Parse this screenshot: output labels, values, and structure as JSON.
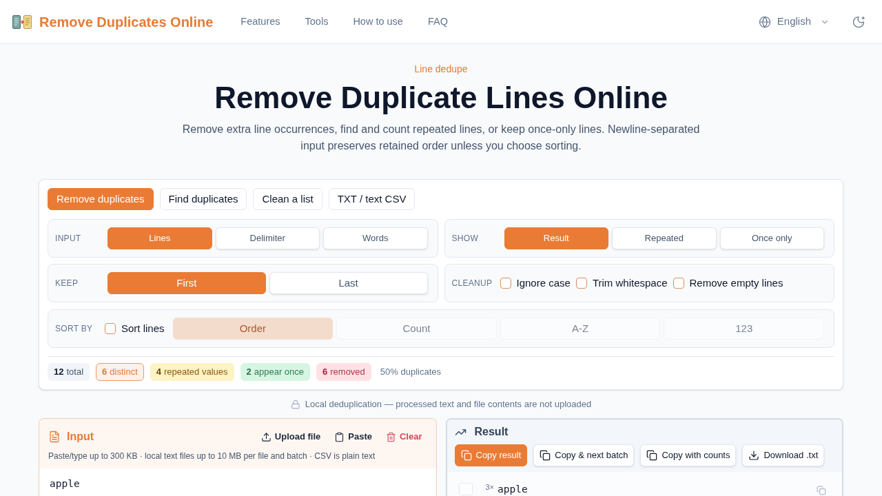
{
  "header": {
    "logo_title": "Remove Duplicates Online",
    "nav": [
      "Features",
      "Tools",
      "How to use",
      "FAQ"
    ],
    "language": "English"
  },
  "hero": {
    "eyebrow": "Line dedupe",
    "title": "Remove Duplicate Lines Online",
    "subtitle": "Remove extra line occurrences, find and count repeated lines, or keep once-only lines. Newline-separated input preserves retained order unless you choose sorting."
  },
  "tool": {
    "modes": [
      {
        "label": "Remove duplicates",
        "selected": true
      },
      {
        "label": "Find duplicates",
        "selected": false
      },
      {
        "label": "Clean a list",
        "selected": false
      },
      {
        "label": "TXT / text CSV",
        "selected": false
      }
    ],
    "input": {
      "label": "INPUT",
      "options": [
        {
          "label": "Lines",
          "selected": true
        },
        {
          "label": "Delimiter",
          "selected": false
        },
        {
          "label": "Words",
          "selected": false
        }
      ]
    },
    "show": {
      "label": "SHOW",
      "options": [
        {
          "label": "Result",
          "selected": true
        },
        {
          "label": "Repeated",
          "selected": false
        },
        {
          "label": "Once only",
          "selected": false
        }
      ]
    },
    "keep": {
      "label": "KEEP",
      "options": [
        {
          "label": "First",
          "selected": true
        },
        {
          "label": "Last",
          "selected": false
        }
      ]
    },
    "cleanup": {
      "label": "CLEANUP",
      "options": [
        {
          "label": "Ignore case",
          "checked": false
        },
        {
          "label": "Trim whitespace",
          "checked": false
        },
        {
          "label": "Remove empty lines",
          "checked": false
        }
      ]
    },
    "sort": {
      "label": "SORT BY",
      "toggle": {
        "label": "Sort lines",
        "checked": false
      },
      "disabled": true,
      "options": [
        {
          "label": "Order",
          "selected": true
        },
        {
          "label": "Count",
          "selected": false
        },
        {
          "label": "A-Z",
          "selected": false
        },
        {
          "label": "123",
          "selected": false
        }
      ]
    },
    "stats": [
      {
        "kind": "total",
        "value": "12",
        "label": "total"
      },
      {
        "kind": "distinct",
        "value": "6",
        "label": "distinct"
      },
      {
        "kind": "repeated",
        "value": "4",
        "label": "repeated values"
      },
      {
        "kind": "once",
        "value": "2",
        "label": "appear once"
      },
      {
        "kind": "removed",
        "value": "6",
        "label": "removed"
      },
      {
        "kind": "note",
        "label": "50% duplicates"
      }
    ]
  },
  "privacy_note": "Local deduplication — processed text and file contents are not uploaded",
  "input_panel": {
    "title": "Input",
    "actions": [
      {
        "kind": "upload",
        "label": "Upload file"
      },
      {
        "kind": "paste",
        "label": "Paste"
      },
      {
        "kind": "clear",
        "label": "Clear"
      }
    ],
    "hint": "Paste/type up to 300 KB · local text files up to 10 MB per file and batch · CSV is plain text",
    "value": "apple"
  },
  "result_panel": {
    "title": "Result",
    "actions": [
      {
        "kind": "copy",
        "label": "Copy result",
        "primary": true
      },
      {
        "kind": "copy",
        "label": "Copy & next batch",
        "primary": false
      },
      {
        "kind": "copy",
        "label": "Copy with counts",
        "primary": false
      },
      {
        "kind": "download",
        "label": "Download .txt",
        "primary": false
      }
    ],
    "rows": [
      {
        "count": "3×",
        "text": "apple",
        "checked": false
      }
    ]
  }
}
